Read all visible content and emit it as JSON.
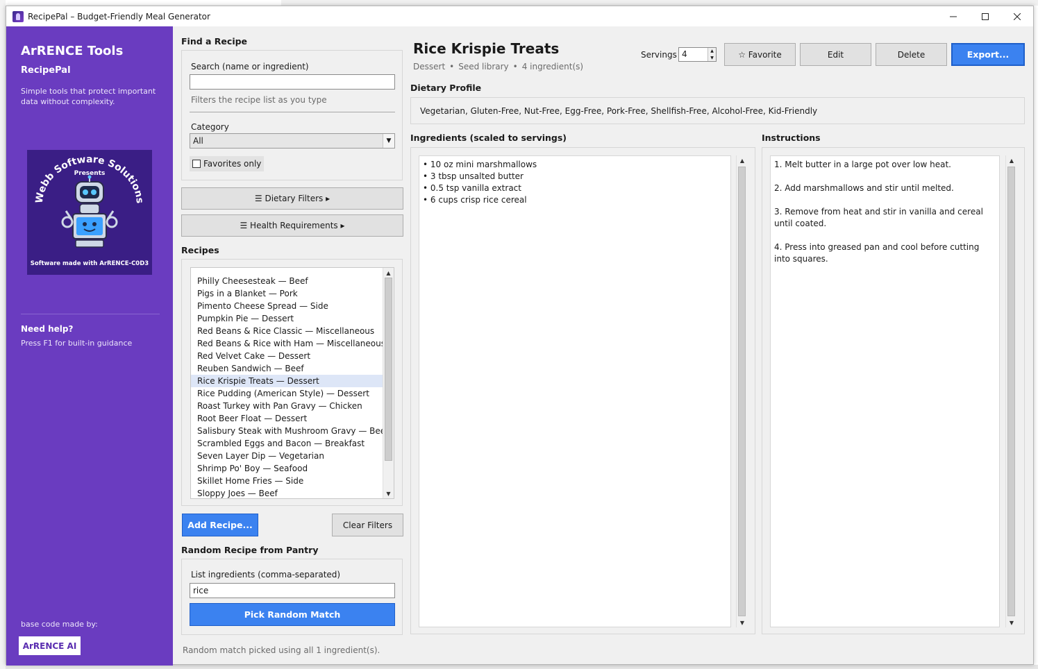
{
  "window": {
    "title": "RecipePal – Budget-Friendly Meal Generator"
  },
  "sidebar": {
    "brand": "ArRENCE Tools",
    "app_name": "RecipePal",
    "tagline": "Simple tools that protect important data without complexity.",
    "logo": {
      "top_text": "Webb Software Solutions",
      "presents": "Presents",
      "bottom_text": "Software made with ArRENCE-C0D3"
    },
    "help_title": "Need help?",
    "help_text": "Press F1 for built-in guidance",
    "base_code_label": "base code made by:",
    "badge": "ArRENCE AI"
  },
  "find": {
    "heading": "Find a Recipe",
    "search_label": "Search (name or ingredient)",
    "search_value": "",
    "search_hint": "Filters the recipe list as you type",
    "category_label": "Category",
    "category_value": "All",
    "favorites_only": "Favorites only",
    "dietary_filters": "☰ Dietary Filters ▸",
    "health_requirements": "☰ Health Requirements ▸"
  },
  "recipes": {
    "heading": "Recipes",
    "items": [
      "Philly Cheesesteak  — Beef",
      "Pigs in a Blanket  — Pork",
      "Pimento Cheese Spread  — Side",
      "Pumpkin Pie  — Dessert",
      "Red Beans & Rice Classic  — Miscellaneous",
      "Red Beans & Rice with Ham  — Miscellaneous",
      "Red Velvet Cake  — Dessert",
      "Reuben Sandwich  — Beef",
      "Rice Krispie Treats  — Dessert",
      "Rice Pudding (American Style)  — Dessert",
      "Roast Turkey with Pan Gravy  — Chicken",
      "Root Beer Float  — Dessert",
      "Salisbury Steak with Mushroom Gravy  — Beef",
      "Scrambled Eggs and Bacon  — Breakfast",
      "Seven Layer Dip  — Vegetarian",
      "Shrimp Po' Boy  — Seafood",
      "Skillet Home Fries  — Side",
      "Sloppy Joes  — Beef"
    ],
    "selected_index": 8,
    "add_button": "Add Recipe...",
    "clear_button": "Clear Filters"
  },
  "pantry": {
    "heading": "Random Recipe from Pantry",
    "label": "List ingredients (comma-separated)",
    "value": "rice",
    "pick_button": "Pick Random Match",
    "status": "Random match picked using all 1 ingredient(s)."
  },
  "recipe": {
    "title": "Rice Krispie Treats",
    "category": "Dessert",
    "source": "Seed library",
    "ingredient_count": "4 ingredient(s)",
    "servings_label": "Servings",
    "servings_value": "4",
    "favorite_button": "☆ Favorite",
    "edit_button": "Edit",
    "delete_button": "Delete",
    "export_button": "Export...",
    "dietary_heading": "Dietary Profile",
    "dietary_profile": "Vegetarian, Gluten-Free, Nut-Free, Egg-Free, Pork-Free, Shellfish-Free, Alcohol-Free, Kid-Friendly",
    "ingredients_heading": "Ingredients (scaled to servings)",
    "ingredients": [
      "• 10 oz mini marshmallows",
      "• 3 tbsp unsalted butter",
      "• 0.5 tsp vanilla extract",
      "• 6 cups crisp rice cereal"
    ],
    "instructions_heading": "Instructions",
    "instructions": [
      "1. Melt butter in a large pot over low heat.",
      "2. Add marshmallows and stir until melted.",
      "3. Remove from heat and stir in vanilla and cereal until coated.",
      "4. Press into greased pan and cool before cutting into squares."
    ]
  },
  "colors": {
    "sidebar": "#6a3cc0",
    "accent": "#3b82f0",
    "selection": "#dde6f7"
  }
}
